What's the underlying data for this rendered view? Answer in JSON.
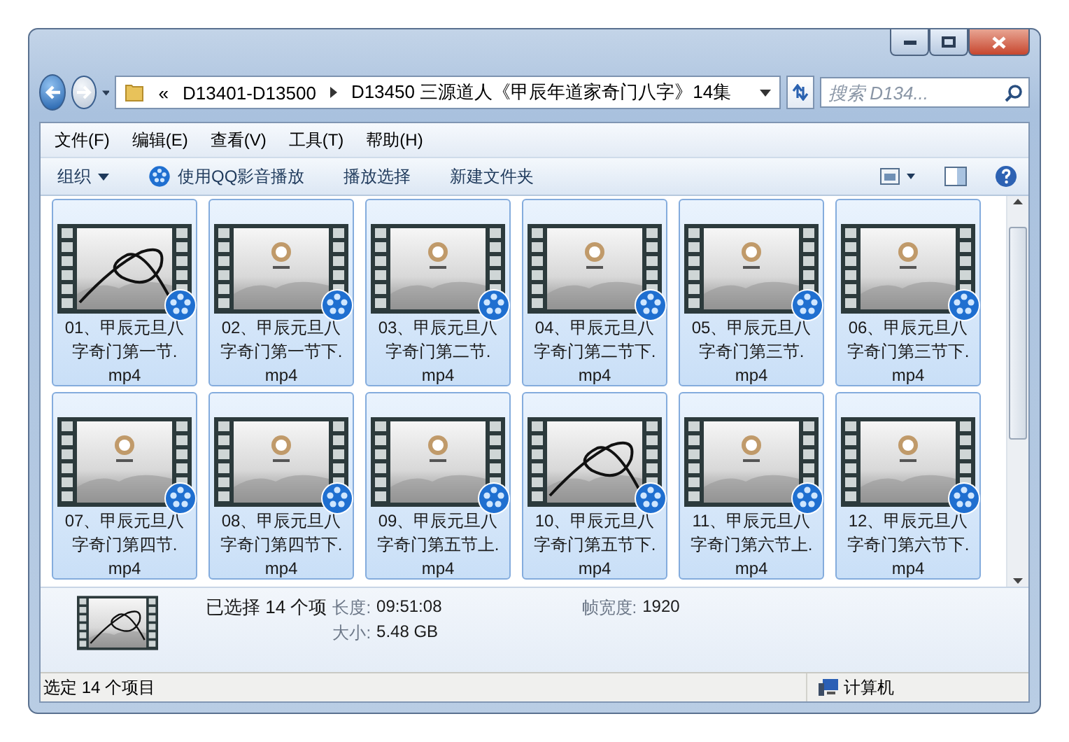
{
  "address": {
    "overflow": "«",
    "breadcrumbs": [
      "D13401-D13500",
      "D13450 三源道人《甲辰年道家奇门八字》14集"
    ]
  },
  "search": {
    "placeholder": "搜索 D134..."
  },
  "menu": [
    "文件(F)",
    "编辑(E)",
    "查看(V)",
    "工具(T)",
    "帮助(H)"
  ],
  "toolbar": [
    {
      "label": "组织",
      "kind": "dropdown"
    },
    {
      "label": "使用QQ影音播放",
      "kind": "app"
    },
    {
      "label": "播放选择",
      "kind": "plain"
    },
    {
      "label": "新建文件夹",
      "kind": "plain"
    }
  ],
  "files": [
    {
      "name": "01、甲辰元旦八字奇门第一节.",
      "extension": "mp4",
      "kind": "ribbon",
      "selected": true
    },
    {
      "name": "02、甲辰元旦八字奇门第一节下.",
      "extension": "mp4",
      "kind": "logo",
      "selected": true
    },
    {
      "name": "03、甲辰元旦八字奇门第二节.",
      "extension": "mp4",
      "kind": "logo",
      "selected": true
    },
    {
      "name": "04、甲辰元旦八字奇门第二节下.",
      "extension": "mp4",
      "kind": "logo",
      "selected": true
    },
    {
      "name": "05、甲辰元旦八字奇门第三节.",
      "extension": "mp4",
      "kind": "logo",
      "selected": true
    },
    {
      "name": "06、甲辰元旦八字奇门第三节下.",
      "extension": "mp4",
      "kind": "logo",
      "selected": true
    },
    {
      "name": "07、甲辰元旦八字奇门第四节.",
      "extension": "mp4",
      "kind": "logo",
      "selected": true
    },
    {
      "name": "08、甲辰元旦八字奇门第四节下.",
      "extension": "mp4",
      "kind": "logo",
      "selected": true
    },
    {
      "name": "09、甲辰元旦八字奇门第五节上.",
      "extension": "mp4",
      "kind": "logo",
      "selected": true
    },
    {
      "name": "10、甲辰元旦八字奇门第五节下.",
      "extension": "mp4",
      "kind": "ribbon",
      "selected": true
    },
    {
      "name": "11、甲辰元旦八字奇门第六节上.",
      "extension": "mp4",
      "kind": "logo",
      "selected": true
    },
    {
      "name": "12、甲辰元旦八字奇门第六节下.",
      "extension": "mp4",
      "kind": "logo",
      "selected": true
    }
  ],
  "details": {
    "summary": "已选择 14 个项",
    "properties": [
      {
        "label": "长度:",
        "value": "09:51:08"
      },
      {
        "label": "大小:",
        "value": "5.48 GB"
      },
      {
        "label": "帧宽度:",
        "value": "1920"
      }
    ]
  },
  "status_bar": {
    "text": "选定 14 个项目",
    "location": "计算机"
  }
}
